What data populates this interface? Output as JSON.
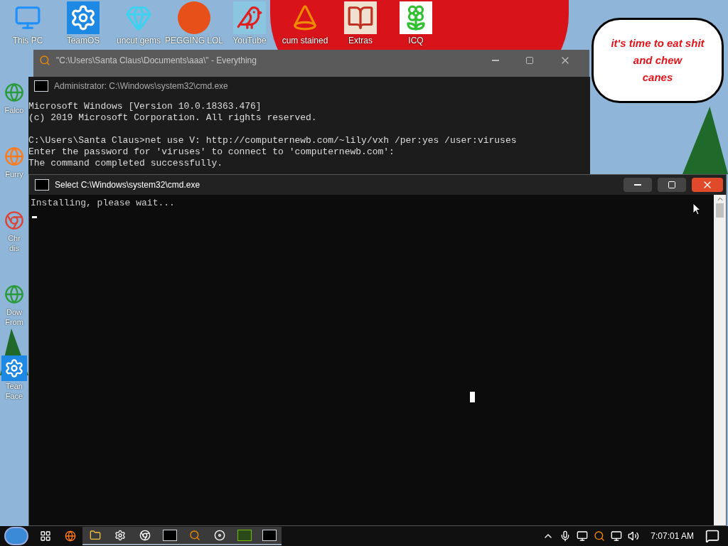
{
  "desktop": {
    "icons": [
      {
        "label": "This PC",
        "kind": "monitor"
      },
      {
        "label": "TeamOS",
        "kind": "gear"
      },
      {
        "label": "uncut gems",
        "kind": "gem"
      },
      {
        "label": "PEGGING LOL",
        "kind": "letter"
      },
      {
        "label": "YouTube",
        "kind": "bird"
      },
      {
        "label": "cum stained",
        "kind": "cone"
      },
      {
        "label": "Extras",
        "kind": "book"
      },
      {
        "label": "ICQ",
        "kind": "flower"
      }
    ],
    "side_icons": [
      {
        "lines": [
          "Falco"
        ],
        "kind": "globe"
      },
      {
        "lines": [
          "Furry"
        ],
        "kind": "fox"
      },
      {
        "lines": [
          "Chr",
          "dis"
        ],
        "kind": "chrome"
      },
      {
        "lines": [
          "Dow",
          "From"
        ],
        "kind": "globe"
      },
      {
        "lines": [
          "Tean",
          "Face"
        ],
        "kind": "gear"
      }
    ],
    "wallpaper_bubble": [
      "it's time to eat shit",
      "and chew",
      "canes"
    ]
  },
  "everything_window": {
    "title": "\"C:\\Users\\Santa Claus\\Documents\\aaa\\\" - Everything"
  },
  "admin_console": {
    "title": "Administrator: C:\\Windows\\system32\\cmd.exe",
    "blocks": [
      [
        "Microsoft Windows [Version 10.0.18363.476]",
        "(c) 2019 Microsoft Corporation. All rights reserved."
      ],
      [
        "C:\\Users\\Santa Claus>net use V: http://computernewb.com/~lily/vxh /per:yes /user:viruses",
        "Enter the password for 'viruses' to connect to 'computernewb.com':",
        "The command completed successfully."
      ]
    ]
  },
  "console": {
    "title": "Select C:\\Windows\\system32\\cmd.exe",
    "lines": [
      "Installing, please wait..."
    ]
  },
  "taskbar": {
    "apps": [
      {
        "kind": "taskview",
        "active": false
      },
      {
        "kind": "firefox",
        "active": false
      },
      {
        "kind": "folder",
        "active": true
      },
      {
        "kind": "gear",
        "active": true
      },
      {
        "kind": "chrome",
        "active": true
      },
      {
        "kind": "console",
        "active": true
      },
      {
        "kind": "search",
        "active": true
      },
      {
        "kind": "disc",
        "active": true
      },
      {
        "kind": "gpu",
        "active": true
      },
      {
        "kind": "console",
        "active": true
      }
    ],
    "clock": "7:07:01 AM"
  }
}
